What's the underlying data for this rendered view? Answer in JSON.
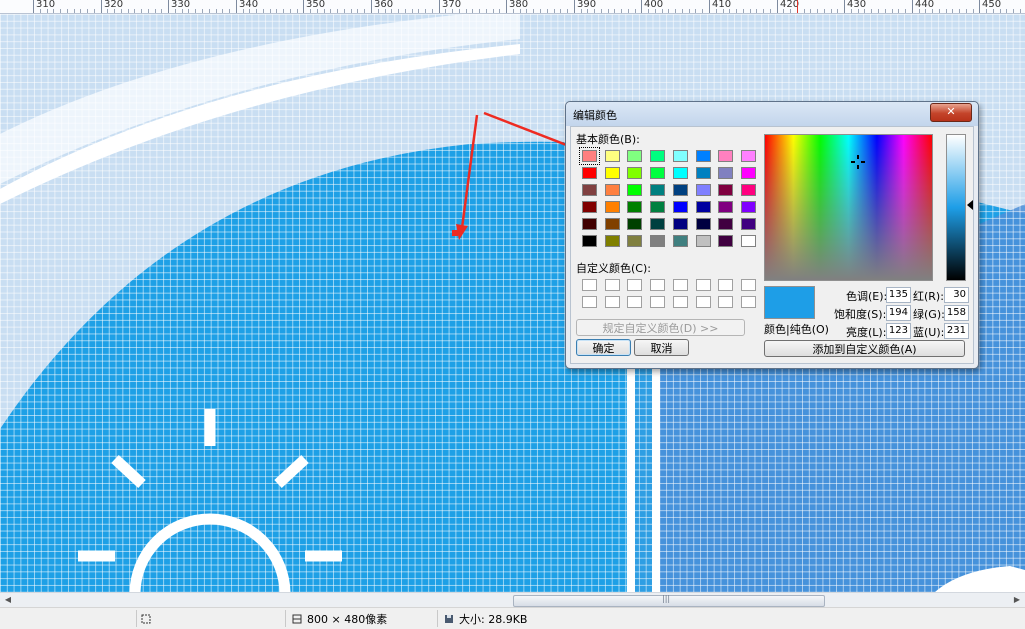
{
  "ruler": {
    "labels": [
      "310",
      "320",
      "330",
      "340",
      "350",
      "360",
      "370",
      "380",
      "390",
      "400",
      "410",
      "420",
      "430",
      "440",
      "450"
    ]
  },
  "canvas": {
    "colors": {
      "background": "#c9def2",
      "sky_band": "#e6f0fa",
      "main_blue": "#1ea0e6",
      "deep_blue": "#2e8fdc",
      "right_blue": "#4d8fd8",
      "white": "#ffffff"
    },
    "icons": [
      "sun-icon"
    ]
  },
  "statusbar": {
    "dimensions": "800 × 480像素",
    "size": "大小: 28.9KB",
    "icons": [
      "select-icon",
      "dimensions-icon",
      "disk-icon"
    ]
  },
  "dialog": {
    "title": "编辑颜色",
    "close_label": "✕",
    "basic_colors_label": "基本颜色(B):",
    "custom_colors_label": "自定义颜色(C):",
    "define_custom_button": "规定自定义颜色(D) >>",
    "ok_button": "确定",
    "cancel_button": "取消",
    "add_custom_button": "添加到自定义颜色(A)",
    "color_solid_label": "颜色|纯色(O)",
    "fields": {
      "hue": {
        "label": "色调(E):",
        "value": "135"
      },
      "saturation": {
        "label": "饱和度(S):",
        "value": "194"
      },
      "luminance": {
        "label": "亮度(L):",
        "value": "123"
      },
      "red": {
        "label": "红(R):",
        "value": "30"
      },
      "green": {
        "label": "绿(G):",
        "value": "158"
      },
      "blue": {
        "label": "蓝(U):",
        "value": "231"
      }
    },
    "preview_color": "#1e9ee7",
    "basic_colors": [
      "#ff8080",
      "#ffff80",
      "#80ff80",
      "#00ff80",
      "#80ffff",
      "#0080ff",
      "#ff80c0",
      "#ff80ff",
      "#ff0000",
      "#ffff00",
      "#80ff00",
      "#00ff40",
      "#00ffff",
      "#0080c0",
      "#8080c0",
      "#ff00ff",
      "#804040",
      "#ff8040",
      "#00ff00",
      "#008080",
      "#004080",
      "#8080ff",
      "#800040",
      "#ff0080",
      "#800000",
      "#ff8000",
      "#008000",
      "#008040",
      "#0000ff",
      "#0000a0",
      "#800080",
      "#8000ff",
      "#400000",
      "#804000",
      "#004000",
      "#004040",
      "#000080",
      "#000040",
      "#400040",
      "#400080",
      "#000000",
      "#808000",
      "#808040",
      "#808080",
      "#408080",
      "#c0c0c0",
      "#400040",
      "#ffffff"
    ]
  },
  "annotation": {
    "arrow_color": "#ee2b22"
  }
}
